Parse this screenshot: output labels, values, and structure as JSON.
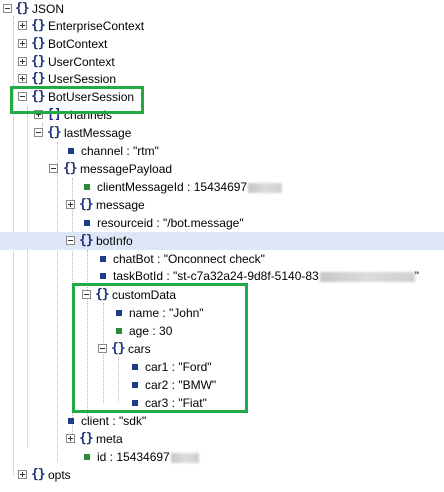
{
  "tree": {
    "root_label": "JSON",
    "enterprise_context": "EnterpriseContext",
    "bot_context": "BotContext",
    "user_context": "UserContext",
    "user_session": "UserSession",
    "bot_user_session": "BotUserSession",
    "channels": "channels",
    "last_message": "lastMessage",
    "channel": "channel : \"rtm\"",
    "message_payload": "messagePayload",
    "client_message_id": "clientMessageId : 15434697",
    "message": "message",
    "resource_id": "resourceid : \"/bot.message\"",
    "bot_info": "botInfo",
    "chat_bot": "chatBot : \"Onconnect check\"",
    "task_bot_id": "taskBotId : \"st-c7a32a24-9d8f-5140-83",
    "task_bot_id_end": "\"",
    "custom_data": "customData",
    "name": "name : \"John\"",
    "age": "age : 30",
    "cars": "cars",
    "car1": "car1 : \"Ford\"",
    "car2": "car2 : \"BMW\"",
    "car3": "car3 : \"Fiat\"",
    "client": "client : \"sdk\"",
    "meta": "meta",
    "id": "id : 15434697",
    "opts": "opts"
  },
  "colors": {
    "highlight": "#22aa44",
    "selected_row": "#dde7f7",
    "object_icon": "#1c2f7c",
    "string_value": "#1e3a8a",
    "number_value": "#2e8b3a"
  }
}
